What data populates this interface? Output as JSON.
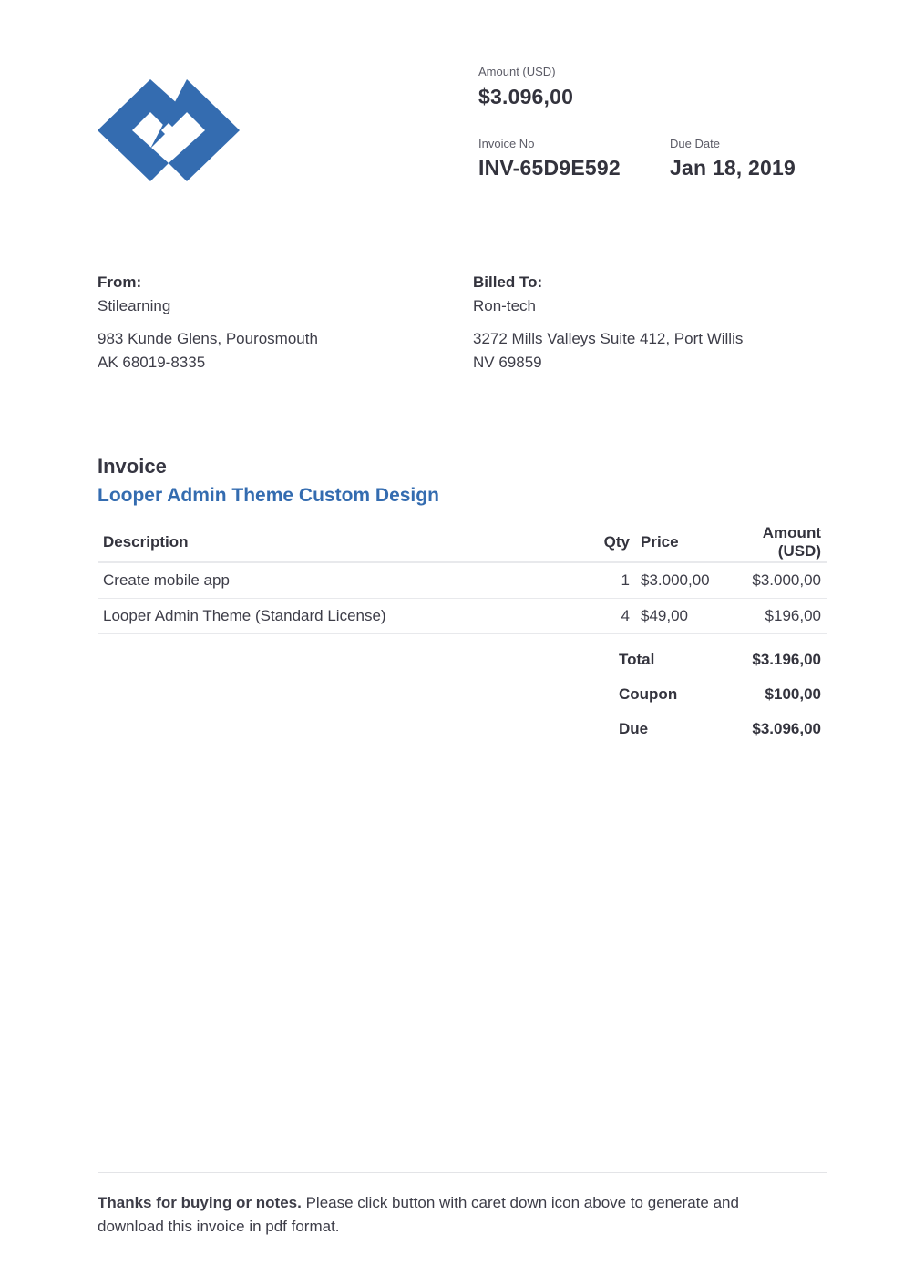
{
  "logo": {
    "name": "looper-logo",
    "color": "#346cb0"
  },
  "summary": {
    "amount_label": "Amount (USD)",
    "amount_value": "$3.096,00",
    "invoice_no_label": "Invoice No",
    "invoice_no_value": "INV-65D9E592",
    "due_date_label": "Due Date",
    "due_date_value": "Jan 18, 2019"
  },
  "from": {
    "heading": "From:",
    "name": "Stilearning",
    "address_line1": "983 Kunde Glens, Pourosmouth",
    "address_line2": "AK 68019-8335"
  },
  "billed_to": {
    "heading": "Billed To:",
    "name": "Ron-tech",
    "address_line1": "3272 Mills Valleys Suite 412, Port Willis",
    "address_line2": "NV 69859"
  },
  "invoice": {
    "title": "Invoice",
    "project": "Looper Admin Theme Custom Design"
  },
  "table": {
    "headers": {
      "description": "Description",
      "qty": "Qty",
      "price": "Price",
      "amount": "Amount (USD)"
    },
    "rows": [
      {
        "description": "Create mobile app",
        "qty": "1",
        "price": "$3.000,00",
        "amount": "$3.000,00"
      },
      {
        "description": "Looper Admin Theme (Standard License)",
        "qty": "4",
        "price": "$49,00",
        "amount": "$196,00"
      }
    ]
  },
  "totals": {
    "total_label": "Total",
    "total_value": "$3.196,00",
    "coupon_label": "Coupon",
    "coupon_value": "$100,00",
    "due_label": "Due",
    "due_value": "$3.096,00"
  },
  "footer": {
    "bold": "Thanks for buying or notes.",
    "text": " Please click button with caret down icon above to generate and download this invoice in pdf format."
  },
  "colors": {
    "accent": "#346cb0",
    "text": "#363642",
    "divider": "#e8e9ec"
  }
}
